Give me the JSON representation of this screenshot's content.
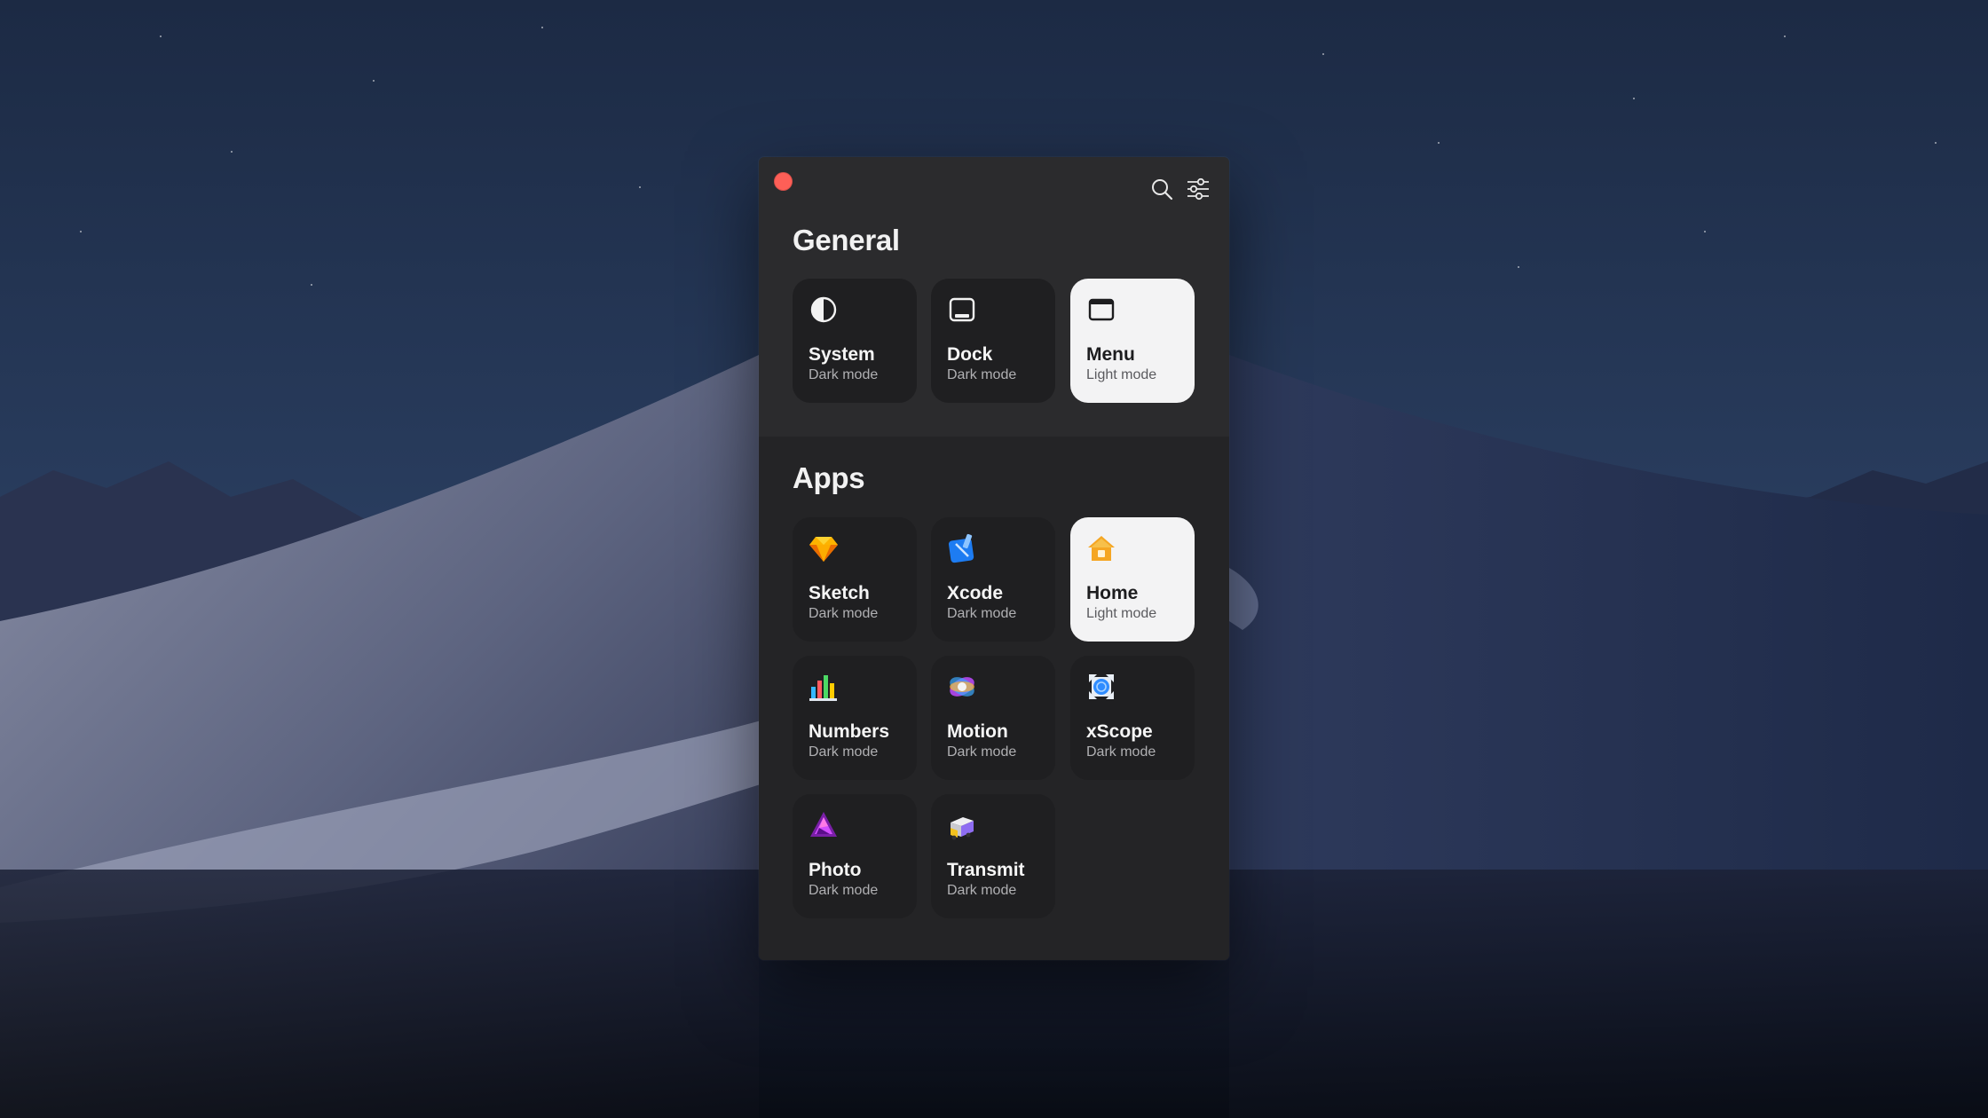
{
  "window": {
    "toolbar": {
      "close_icon": "close-icon",
      "search_icon": "search-icon",
      "preferences_icon": "sliders-icon"
    }
  },
  "general": {
    "title": "General",
    "tiles": [
      {
        "name": "System",
        "mode": "Dark mode",
        "theme": "dark",
        "icon": "half-circle-icon"
      },
      {
        "name": "Dock",
        "mode": "Dark mode",
        "theme": "dark",
        "icon": "dock-icon"
      },
      {
        "name": "Menu",
        "mode": "Light mode",
        "theme": "light",
        "icon": "window-icon"
      }
    ]
  },
  "apps": {
    "title": "Apps",
    "tiles": [
      {
        "name": "Sketch",
        "mode": "Dark mode",
        "theme": "dark",
        "icon": "sketch-icon"
      },
      {
        "name": "Xcode",
        "mode": "Dark mode",
        "theme": "dark",
        "icon": "xcode-icon"
      },
      {
        "name": "Home",
        "mode": "Light mode",
        "theme": "light",
        "icon": "home-icon"
      },
      {
        "name": "Numbers",
        "mode": "Dark mode",
        "theme": "dark",
        "icon": "numbers-icon"
      },
      {
        "name": "Motion",
        "mode": "Dark mode",
        "theme": "dark",
        "icon": "motion-icon"
      },
      {
        "name": "xScope",
        "mode": "Dark mode",
        "theme": "dark",
        "icon": "xscope-icon"
      },
      {
        "name": "Photo",
        "mode": "Dark mode",
        "theme": "dark",
        "icon": "affinity-photo-icon"
      },
      {
        "name": "Transmit",
        "mode": "Dark mode",
        "theme": "dark",
        "icon": "transmit-icon"
      }
    ]
  },
  "colors": {
    "window_bg": "#2b2b2d",
    "apps_bg": "#242426",
    "tile_dark": "#1f1f21",
    "tile_light": "#f3f3f4",
    "close_red": "#fe5f57"
  }
}
